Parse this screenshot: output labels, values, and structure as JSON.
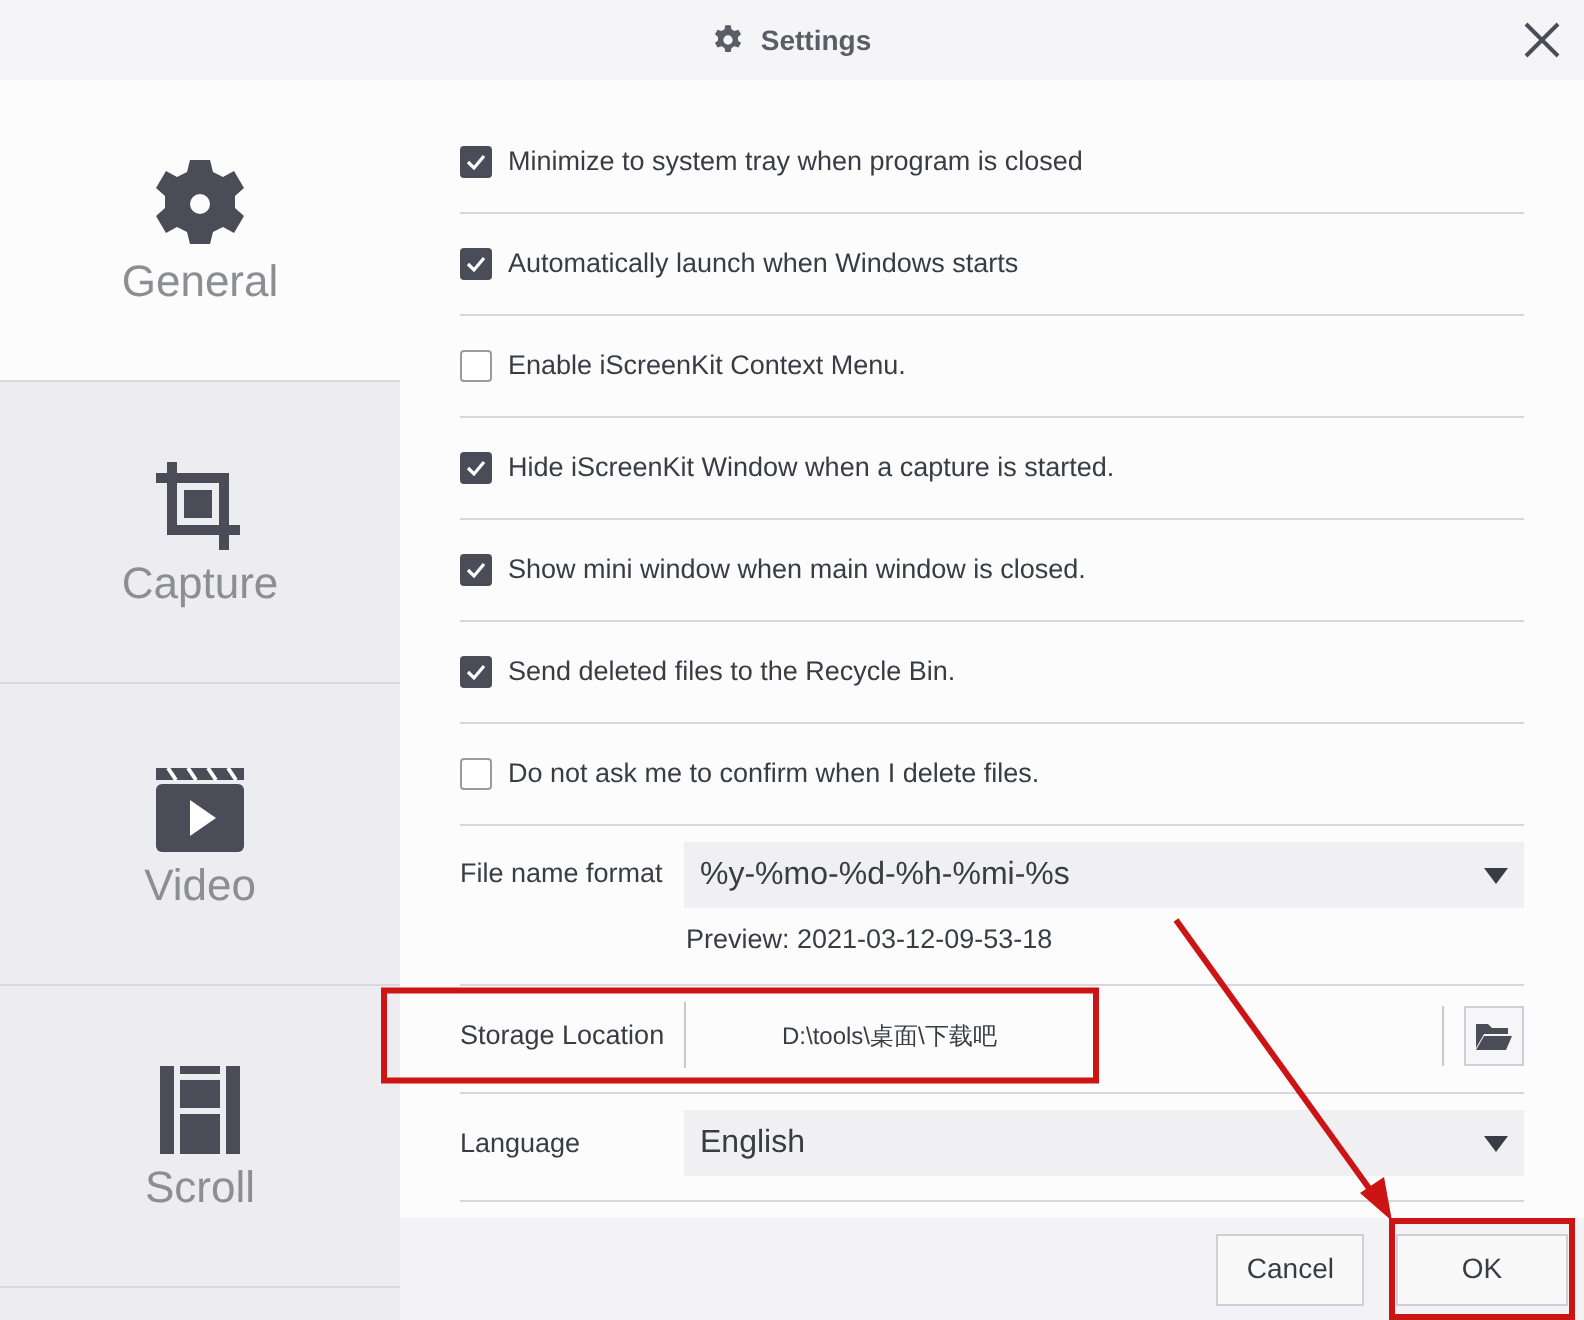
{
  "window": {
    "title": "Settings"
  },
  "sidebar": {
    "items": [
      {
        "label": "General",
        "selected": true
      },
      {
        "label": "Capture",
        "selected": false
      },
      {
        "label": "Video",
        "selected": false
      },
      {
        "label": "Scroll",
        "selected": false
      }
    ]
  },
  "options": [
    {
      "label": "Minimize to system tray when program is closed",
      "checked": true
    },
    {
      "label": "Automatically launch when Windows starts",
      "checked": true
    },
    {
      "label": "Enable iScreenKit Context Menu.",
      "checked": false
    },
    {
      "label": "Hide iScreenKit Window when a capture is started.",
      "checked": true
    },
    {
      "label": "Show mini window when main window is closed.",
      "checked": true
    },
    {
      "label": "Send deleted files to the Recycle Bin.",
      "checked": true
    },
    {
      "label": "Do not ask me to confirm when I delete files.",
      "checked": false
    }
  ],
  "fields": [
    {
      "kind": "select",
      "label": "File name format",
      "value": "%y-%mo-%d-%h-%mi-%s",
      "note": "Preview: 2021-03-12-09-53-18",
      "highlighted": false
    },
    {
      "kind": "path",
      "label": "Storage Location",
      "value": "D:\\tools\\桌面\\下载吧",
      "highlighted": true
    },
    {
      "kind": "select",
      "label": "Language",
      "value": "English",
      "highlighted": false
    }
  ],
  "buttons": [
    {
      "label": "Cancel",
      "highlighted": false
    },
    {
      "label": "OK",
      "highlighted": true
    }
  ],
  "callout_arrow": true
}
